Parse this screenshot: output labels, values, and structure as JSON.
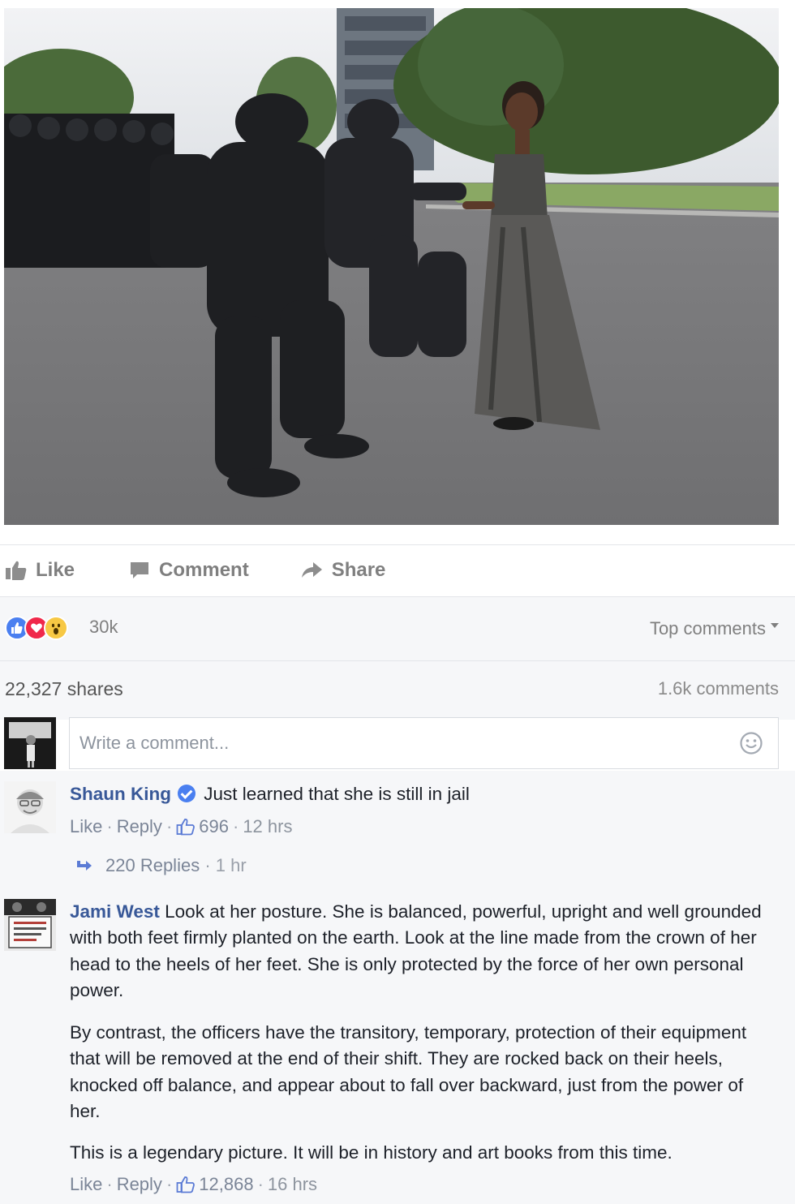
{
  "post": {
    "photo_alt": "",
    "actions": {
      "like_label": "Like",
      "comment_label": "Comment",
      "share_label": "Share"
    }
  },
  "reactions": {
    "icons": [
      "like-icon",
      "love-icon",
      "wow-icon"
    ],
    "count": "30k",
    "sort_label": "Top comments"
  },
  "stats": {
    "shares": "22,327 shares",
    "comments": "1.6k comments"
  },
  "composer": {
    "placeholder": "Write a comment..."
  },
  "comments": [
    {
      "author": "Shaun King",
      "verified": true,
      "text": "Just learned that she is still in jail",
      "like_label": "Like",
      "reply_label": "Reply",
      "likes": "696",
      "time": "12 hrs",
      "replies": {
        "label": "220 Replies",
        "time": "1 hr"
      }
    },
    {
      "author": "Jami West",
      "verified": false,
      "paragraphs": [
        "Look at her posture. She is balanced, powerful, upright and well grounded with both feet firmly planted on the earth. Look at the line made from the crown of her head to the heels of her feet. She is only protected by the force of her own personal power.",
        "By contrast, the officers have the transitory, temporary, protection of their equipment that will be removed at the end of their shift. They are rocked back on their heels, knocked off balance, and appear about to fall over backward, just from the power of her.",
        "This is a legendary picture. It will be in history and art books from this time."
      ],
      "like_label": "Like",
      "reply_label": "Reply",
      "likes": "12,868",
      "time": "16 hrs"
    }
  ],
  "colors": {
    "link": "#385898",
    "meta": "#8d949e",
    "like_blue": "#4a7ff0",
    "love_red": "#f0284a",
    "wow_yellow": "#f7c844"
  }
}
